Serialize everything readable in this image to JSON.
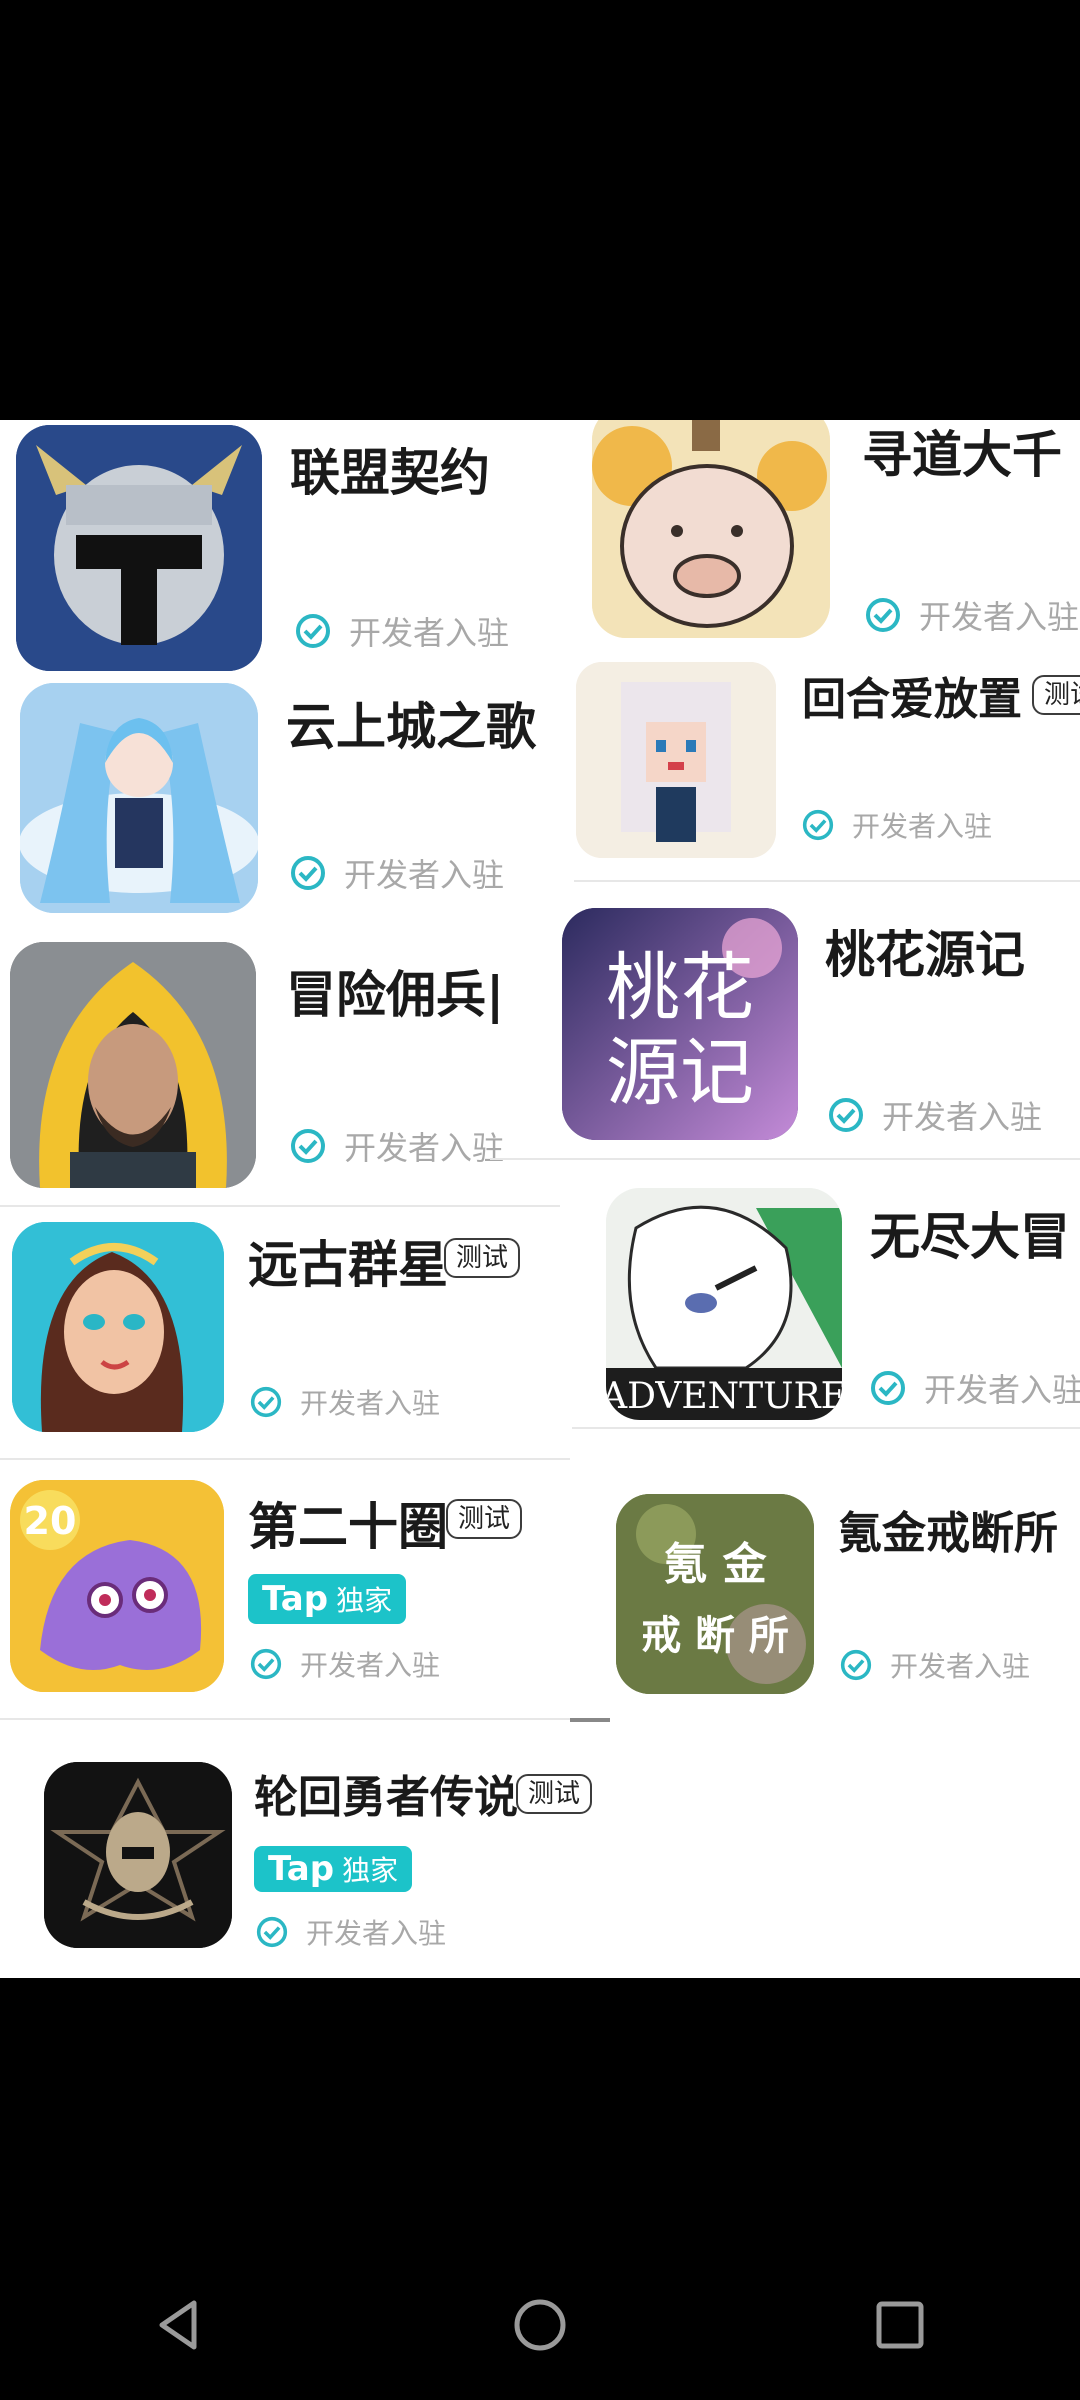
{
  "games": [
    {
      "title": "联盟契约",
      "badge": "",
      "dev": "开发者入驻"
    },
    {
      "title": "寻道大千",
      "badge": "",
      "dev": "开发者入驻"
    },
    {
      "title": "云上城之歌",
      "badge": "",
      "dev": "开发者入驻"
    },
    {
      "title": "回合爱放置",
      "badge": "测试",
      "dev": "开发者入驻"
    },
    {
      "title": "冒险佣兵|",
      "badge": "",
      "dev": "开发者入驻"
    },
    {
      "title": "桃花源记",
      "badge": "",
      "dev": "开发者入驻",
      "icon_text": [
        "桃花",
        "源记"
      ]
    },
    {
      "title": "远古群星",
      "badge": "测试",
      "dev": "开发者入驻"
    },
    {
      "title": "无尽大冒",
      "badge": "",
      "dev": "开发者入驻",
      "icon_text": "ADVENTURE"
    },
    {
      "title": "第二十圈",
      "badge": "测试",
      "tap": "Tap",
      "tap_sub": "独家",
      "dev": "开发者入驻",
      "icon_text": "20"
    },
    {
      "title": "氪金戒断所",
      "badge": "",
      "dev": "开发者入驻",
      "icon_text": [
        "氪 金",
        "戒 断 所"
      ]
    },
    {
      "title": "轮回勇者传说",
      "badge": "测试",
      "tap": "Tap",
      "tap_sub": "独家",
      "dev": "开发者入驻"
    }
  ],
  "colors": {
    "tap_brand": "#1cc3c9",
    "check": "#2bb7c4"
  },
  "nav": {
    "back": "back-icon",
    "home": "home-icon",
    "recents": "recents-icon"
  }
}
